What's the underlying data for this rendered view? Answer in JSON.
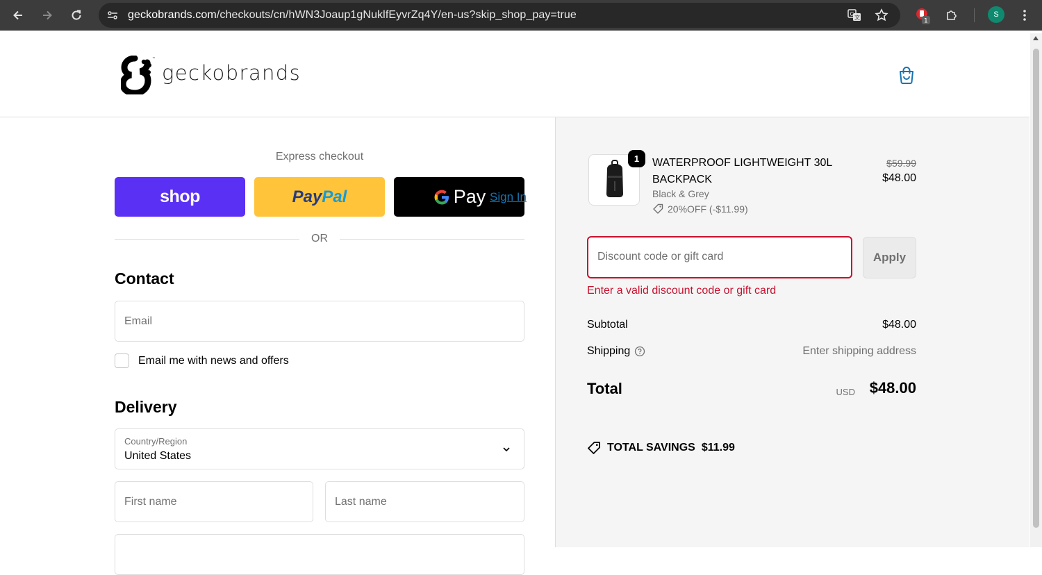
{
  "browser": {
    "url_host": "geckobrands.com",
    "url_path": "/checkouts/cn/hWN3Joaup1gNuklfEyvrZq4Y/en-us?skip_shop_pay=true",
    "extension_badge": "1",
    "profile_initial": "S"
  },
  "header": {
    "brand": "geckobrands"
  },
  "express": {
    "title": "Express checkout",
    "shop_label": "shop",
    "paypal_part1": "Pay",
    "paypal_part2": "Pal",
    "gpay_label": "Pay",
    "or_text": "OR"
  },
  "contact": {
    "title": "Contact",
    "sign_in": "Sign In",
    "email_placeholder": "Email",
    "newsletter_label": "Email me with news and offers"
  },
  "delivery": {
    "title": "Delivery",
    "country_label": "Country/Region",
    "country_value": "United States",
    "first_name_placeholder": "First name",
    "last_name_placeholder": "Last name"
  },
  "summary": {
    "quantity": "1",
    "product_name": "WATERPROOF LIGHTWEIGHT 30L BACKPACK",
    "variant": "Black & Grey",
    "discount_tag": "20%OFF (-$11.99)",
    "original_price": "$59.99",
    "price": "$48.00",
    "discount_placeholder": "Discount code or gift card",
    "apply_label": "Apply",
    "discount_error": "Enter a valid discount code or gift card",
    "subtotal_label": "Subtotal",
    "subtotal_value": "$48.00",
    "shipping_label": "Shipping",
    "shipping_value": "Enter shipping address",
    "total_label": "Total",
    "currency": "USD",
    "total_value": "$48.00",
    "savings_label": "TOTAL SAVINGS",
    "savings_value": "$11.99"
  },
  "colors": {
    "shop_purple": "#5a31f4",
    "paypal_yellow": "#ffc439",
    "link_blue": "#1773b0",
    "error_red": "#c8102e"
  }
}
